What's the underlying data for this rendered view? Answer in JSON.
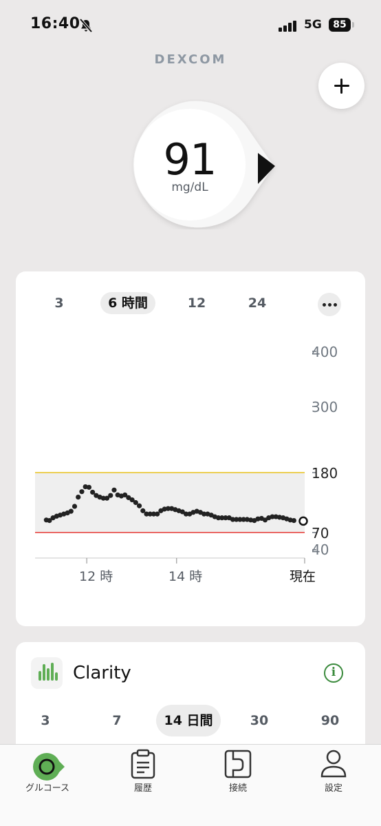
{
  "status_bar": {
    "time": "16:40",
    "network": "5G",
    "battery": "85",
    "bell_icon": "bell-slash-icon",
    "signal_icon": "cellular-signal-icon"
  },
  "brand": "DEXCOM",
  "reading": {
    "value": "91",
    "unit": "mg/dL",
    "trend_icon": "trend-arrow-right-icon"
  },
  "graph": {
    "range_tabs": [
      {
        "label": "3",
        "active": false
      },
      {
        "label": "6 時間",
        "active": true
      },
      {
        "label": "12",
        "active": false
      },
      {
        "label": "24",
        "active": false
      }
    ],
    "more_icon": "ellipsis-icon"
  },
  "chart_data": {
    "type": "scatter",
    "y_ticks": [
      "400",
      "300",
      "180",
      "70",
      "40"
    ],
    "x_ticks": [
      "12 時",
      "14 時",
      "現在"
    ],
    "target_range": {
      "low": 70,
      "high": 180
    },
    "high_line_color": "#e8c21d",
    "low_line_color": "#e53935",
    "x_unit": "hours_before_now",
    "ylim": [
      40,
      400
    ],
    "series": [
      {
        "values": [
          [
            -5.75,
            93
          ],
          [
            -5.68,
            92
          ],
          [
            -5.6,
            97
          ],
          [
            -5.52,
            100
          ],
          [
            -5.44,
            102
          ],
          [
            -5.36,
            104
          ],
          [
            -5.28,
            106
          ],
          [
            -5.2,
            109
          ],
          [
            -5.12,
            118
          ],
          [
            -5.04,
            135
          ],
          [
            -4.96,
            145
          ],
          [
            -4.88,
            154
          ],
          [
            -4.8,
            153
          ],
          [
            -4.72,
            144
          ],
          [
            -4.64,
            138
          ],
          [
            -4.56,
            135
          ],
          [
            -4.48,
            133
          ],
          [
            -4.4,
            133
          ],
          [
            -4.32,
            138
          ],
          [
            -4.24,
            148
          ],
          [
            -4.16,
            139
          ],
          [
            -4.08,
            137
          ],
          [
            -4,
            139
          ],
          [
            -3.92,
            134
          ],
          [
            -3.84,
            130
          ],
          [
            -3.76,
            125
          ],
          [
            -3.68,
            119
          ],
          [
            -3.6,
            110
          ],
          [
            -3.52,
            104
          ],
          [
            -3.44,
            104
          ],
          [
            -3.36,
            104
          ],
          [
            -3.28,
            104
          ],
          [
            -3.2,
            110
          ],
          [
            -3.12,
            113
          ],
          [
            -3.04,
            114
          ],
          [
            -2.96,
            114
          ],
          [
            -2.88,
            112
          ],
          [
            -2.8,
            110
          ],
          [
            -2.72,
            108
          ],
          [
            -2.64,
            104
          ],
          [
            -2.56,
            104
          ],
          [
            -2.48,
            107
          ],
          [
            -2.4,
            109
          ],
          [
            -2.32,
            107
          ],
          [
            -2.24,
            104
          ],
          [
            -2.16,
            104
          ],
          [
            -2.08,
            102
          ],
          [
            -2,
            99
          ],
          [
            -1.92,
            97
          ],
          [
            -1.84,
            97
          ],
          [
            -1.76,
            97
          ],
          [
            -1.68,
            97
          ],
          [
            -1.6,
            94
          ],
          [
            -1.52,
            94
          ],
          [
            -1.44,
            94
          ],
          [
            -1.36,
            94
          ],
          [
            -1.28,
            94
          ],
          [
            -1.2,
            93
          ],
          [
            -1.12,
            92
          ],
          [
            -1.04,
            95
          ],
          [
            -0.96,
            96
          ],
          [
            -0.88,
            93
          ],
          [
            -0.8,
            97
          ],
          [
            -0.72,
            99
          ],
          [
            -0.64,
            99
          ],
          [
            -0.56,
            98
          ],
          [
            -0.48,
            97
          ],
          [
            -0.4,
            95
          ],
          [
            -0.32,
            93
          ],
          [
            -0.24,
            92
          ],
          [
            0,
            91
          ]
        ]
      }
    ]
  },
  "clarity": {
    "title": "Clarity",
    "icon": "clarity-chart-icon",
    "info_icon": "info-icon",
    "day_tabs": [
      {
        "label": "3",
        "active": false
      },
      {
        "label": "7",
        "active": false
      },
      {
        "label": "14 日間",
        "active": true
      },
      {
        "label": "30",
        "active": false
      },
      {
        "label": "90",
        "active": false
      }
    ]
  },
  "tabbar": {
    "glucose": "グルコース",
    "history": "履歴",
    "connection": "接続",
    "settings": "設定"
  },
  "colors": {
    "accent_green": "#5fae55",
    "background": "#ebe9e9"
  }
}
